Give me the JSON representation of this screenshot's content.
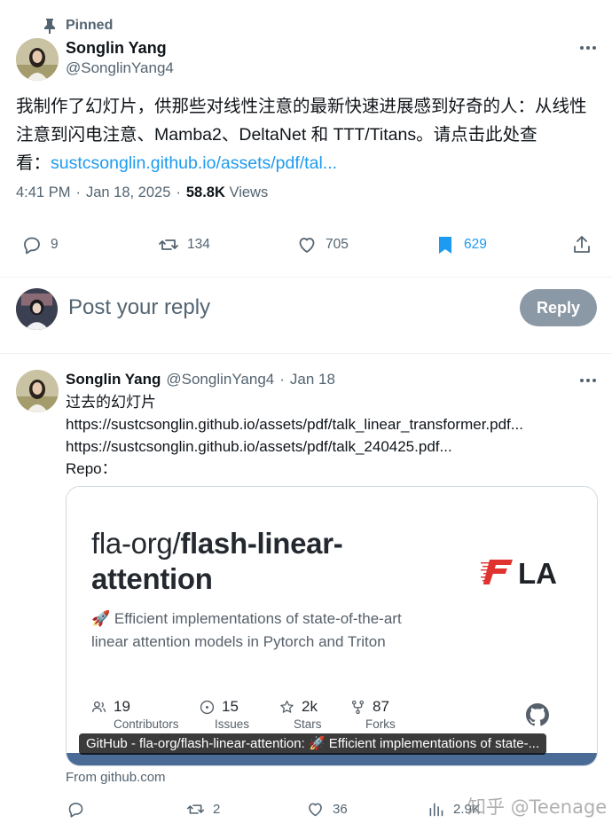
{
  "pinned": {
    "label": "Pinned",
    "icon": "pin-icon"
  },
  "author": {
    "name": "Songlin Yang",
    "handle": "@SonglinYang4"
  },
  "tweet": {
    "line1": "我制作了幻灯片，供那些对线性注意的最新快速进展感到好奇的人：从线性",
    "line2": "注意到闪电注意、Mamba2、DeltaNet 和 TTT/Titans。请点击此处查",
    "line3_prefix": "看：",
    "link": "sustcsonglin.github.io/assets/pdf/tal..."
  },
  "meta": {
    "time": "4:41 PM",
    "dot1": "·",
    "date": "Jan 18, 2025",
    "dot2": "·",
    "views_count": "58.8K",
    "views_label": "Views"
  },
  "actions": {
    "replies": "9",
    "reposts": "134",
    "likes": "705",
    "bookmarks": "629"
  },
  "composer": {
    "placeholder": "Post your reply",
    "button": "Reply"
  },
  "reply": {
    "name": "Songlin Yang",
    "handle": "@SonglinYang4",
    "dot": "·",
    "date": "Jan 18",
    "line1": "过去的幻灯片",
    "line2": "https://sustcsonglin.github.io/assets/pdf/talk_linear_transformer.pdf...",
    "line3": "https://sustcsonglin.github.io/assets/pdf/talk_240425.pdf...",
    "line4": "Repo："
  },
  "card": {
    "title_prefix": "fla-org/",
    "title_bold1": "flash-linear-",
    "title_bold2": "attention",
    "desc_line1": "🚀 Efficient implementations of state-of-the-art",
    "desc_line2": "linear attention models in Pytorch and Triton",
    "logo_text": "LA",
    "stats": [
      {
        "value": "19",
        "label": "Contributors"
      },
      {
        "value": "15",
        "label": "Issues"
      },
      {
        "value": "2k",
        "label": "Stars"
      },
      {
        "value": "87",
        "label": "Forks"
      }
    ],
    "caption": "GitHub - fla-org/flash-linear-attention: 🚀 Efficient implementations of state-...",
    "from": "From github.com"
  },
  "reply_actions": {
    "replies": "",
    "reposts": "2",
    "likes": "36",
    "views": "2.9K"
  },
  "watermark": "知乎 @Teenage",
  "colors": {
    "link": "#1d9bf0",
    "bookmark": "#1d9bf0",
    "muted": "#536471",
    "reply_button": "#8b98a5",
    "fla_red": "#e0322f"
  }
}
